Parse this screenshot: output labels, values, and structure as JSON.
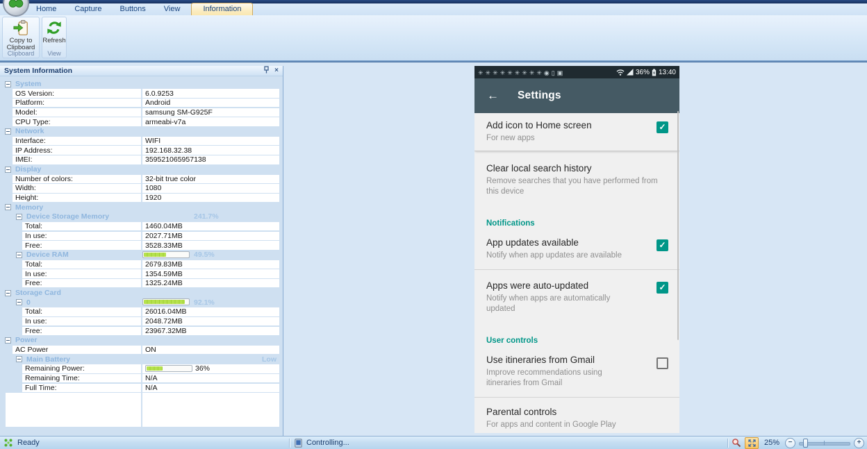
{
  "ribbon": {
    "tabs": [
      {
        "label": "Home",
        "active": false
      },
      {
        "label": "Capture",
        "active": false
      },
      {
        "label": "Buttons",
        "active": false
      },
      {
        "label": "View",
        "active": false
      },
      {
        "label": "Information",
        "active": true
      }
    ],
    "groups": [
      {
        "label": "Clipboard",
        "buttons": [
          {
            "label": "Copy to Clipboard",
            "icon": "copy-to-clipboard-icon"
          }
        ]
      },
      {
        "label": "View",
        "buttons": [
          {
            "label": "Refresh",
            "icon": "refresh-icon"
          }
        ]
      }
    ]
  },
  "panel": {
    "title": "System Information",
    "icons": [
      "pin-icon",
      "close-icon"
    ],
    "rows": [
      {
        "t": "sec",
        "lvl": 1,
        "label": "System"
      },
      {
        "t": "row",
        "lvl": 1,
        "label": "OS Version:",
        "value": "6.0.9253"
      },
      {
        "t": "row",
        "lvl": 1,
        "label": "Platform:",
        "value": "Android"
      },
      {
        "t": "row",
        "lvl": 1,
        "label": "Model:",
        "value": "samsung SM-G925F"
      },
      {
        "t": "row",
        "lvl": 1,
        "label": "CPU Type:",
        "value": "armeabi-v7a"
      },
      {
        "t": "sec",
        "lvl": 1,
        "label": "Network"
      },
      {
        "t": "row",
        "lvl": 1,
        "label": "Interface:",
        "value": "WIFI"
      },
      {
        "t": "row",
        "lvl": 1,
        "label": "IP Address:",
        "value": "192.168.32.38"
      },
      {
        "t": "row",
        "lvl": 1,
        "label": "IMEI:",
        "value": "359521065957138"
      },
      {
        "t": "sec",
        "lvl": 1,
        "label": "Display"
      },
      {
        "t": "row",
        "lvl": 1,
        "label": "Number of colors:",
        "value": "32-bit true color"
      },
      {
        "t": "row",
        "lvl": 1,
        "label": "Width:",
        "value": "1080"
      },
      {
        "t": "row",
        "lvl": 1,
        "label": "Height:",
        "value": "1920"
      },
      {
        "t": "sec",
        "lvl": 1,
        "label": "Memory"
      },
      {
        "t": "sec",
        "lvl": 2,
        "label": "Device Storage Memory",
        "pct": "241.7%"
      },
      {
        "t": "row",
        "lvl": 2,
        "label": "Total:",
        "value": "1460.04MB"
      },
      {
        "t": "row",
        "lvl": 2,
        "label": "In use:",
        "value": "2027.71MB"
      },
      {
        "t": "row",
        "lvl": 2,
        "label": "Free:",
        "value": "3528.33MB"
      },
      {
        "t": "sec",
        "lvl": 2,
        "label": "Device RAM",
        "bar": 49.5,
        "pct": "49.5%"
      },
      {
        "t": "row",
        "lvl": 2,
        "label": "Total:",
        "value": "2679.83MB"
      },
      {
        "t": "row",
        "lvl": 2,
        "label": "In use:",
        "value": "1354.59MB"
      },
      {
        "t": "row",
        "lvl": 2,
        "label": "Free:",
        "value": "1325.24MB"
      },
      {
        "t": "sec",
        "lvl": 1,
        "label": "Storage Card"
      },
      {
        "t": "sec",
        "lvl": 2,
        "label": "0",
        "bar": 92.1,
        "pct": "92.1%"
      },
      {
        "t": "row",
        "lvl": 2,
        "label": "Total:",
        "value": "26016.04MB"
      },
      {
        "t": "row",
        "lvl": 2,
        "label": "In use:",
        "value": "2048.72MB"
      },
      {
        "t": "row",
        "lvl": 2,
        "label": "Free:",
        "value": "23967.32MB"
      },
      {
        "t": "sec",
        "lvl": 1,
        "label": "Power"
      },
      {
        "t": "row",
        "lvl": 1,
        "label": "AC Power",
        "value": "ON"
      },
      {
        "t": "sec",
        "lvl": 2,
        "label": "Main Battery",
        "right": "Low"
      },
      {
        "t": "row",
        "lvl": 2,
        "label": "Remaining Power:",
        "valbar": 36,
        "value": "36%"
      },
      {
        "t": "row",
        "lvl": 2,
        "label": "Remaining Time:",
        "value": "N/A"
      },
      {
        "t": "row",
        "lvl": 2,
        "label": "Full Time:",
        "value": "N/A"
      }
    ]
  },
  "device": {
    "status_bar": {
      "notification_glyph": "✳",
      "notification_count": 9,
      "extra_icons": [
        {
          "name": "shield-icon",
          "glyph": "◉"
        },
        {
          "name": "phone-icon",
          "glyph": "▯"
        },
        {
          "name": "briefcase-icon",
          "glyph": "▣"
        }
      ],
      "battery_percent": "36%",
      "time": "13:40"
    },
    "header": {
      "back_glyph": "←",
      "title": "Settings"
    },
    "items": [
      {
        "type": "item",
        "title": "Add icon to Home screen",
        "subtitle": "For new apps",
        "checkbox": "checked",
        "divider": "card"
      },
      {
        "type": "item",
        "title": "Clear local search history",
        "subtitle": "Remove searches that you have performed from this device",
        "checkbox": null,
        "divider": null
      },
      {
        "type": "header",
        "title": "Notifications"
      },
      {
        "type": "item",
        "title": "App updates available",
        "subtitle": "Notify when app updates are available",
        "checkbox": "checked",
        "divider": "line"
      },
      {
        "type": "item",
        "title": "Apps were auto-updated",
        "subtitle": "Notify when apps are automatically updated",
        "checkbox": "checked",
        "divider": null
      },
      {
        "type": "header",
        "title": "User controls"
      },
      {
        "type": "item",
        "title": "Use itineraries from Gmail",
        "subtitle": "Improve recommendations using itineraries from Gmail",
        "checkbox": "unchecked",
        "divider": "line"
      },
      {
        "type": "item",
        "title": "Parental controls",
        "subtitle": "For apps and content in Google Play",
        "checkbox": null,
        "divider": "line"
      }
    ]
  },
  "status_bar": {
    "ready": "Ready",
    "controlling": "Controlling...",
    "zoom_level": "25%",
    "zoom_out_glyph": "−",
    "zoom_in_glyph": "+"
  },
  "colors": {
    "accent_teal": "#009688",
    "android_header": "#455a64",
    "android_statusbar": "#1f2a30",
    "tree_section_text": "#8fb6de",
    "progress_green": "#a9d63a",
    "active_tab_cream": "#fbecc0"
  }
}
